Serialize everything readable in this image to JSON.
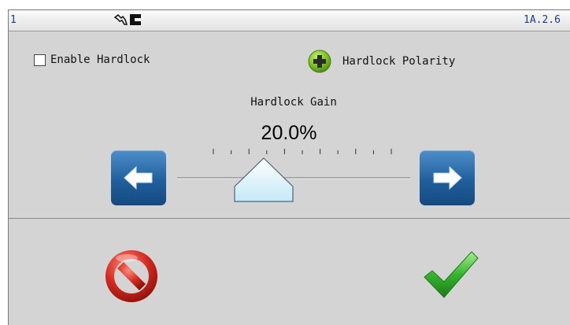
{
  "statusbar": {
    "left_text": "1",
    "right_text": "1A.2.6",
    "icon": "hand-print-icon"
  },
  "options": {
    "enable_hardlock_label": "Enable Hardlock",
    "enable_hardlock_checked": false,
    "hardlock_polarity_label": "Hardlock Polarity",
    "polarity_icon": "plus-circle-icon"
  },
  "gain": {
    "title": "Hardlock Gain",
    "value_text": "20.0%",
    "value_percent": 20.0,
    "min": 0,
    "max": 100,
    "tick_count": 11
  },
  "buttons": {
    "decrease_icon": "arrow-left-icon",
    "increase_icon": "arrow-right-icon",
    "cancel_icon": "no-entry-icon",
    "ok_icon": "checkmark-icon"
  },
  "colors": {
    "accent_blue": "#1f5f9e",
    "cancel_red": "#d42a1f",
    "ok_green": "#34b52d",
    "plus_green": "#7cc324"
  }
}
